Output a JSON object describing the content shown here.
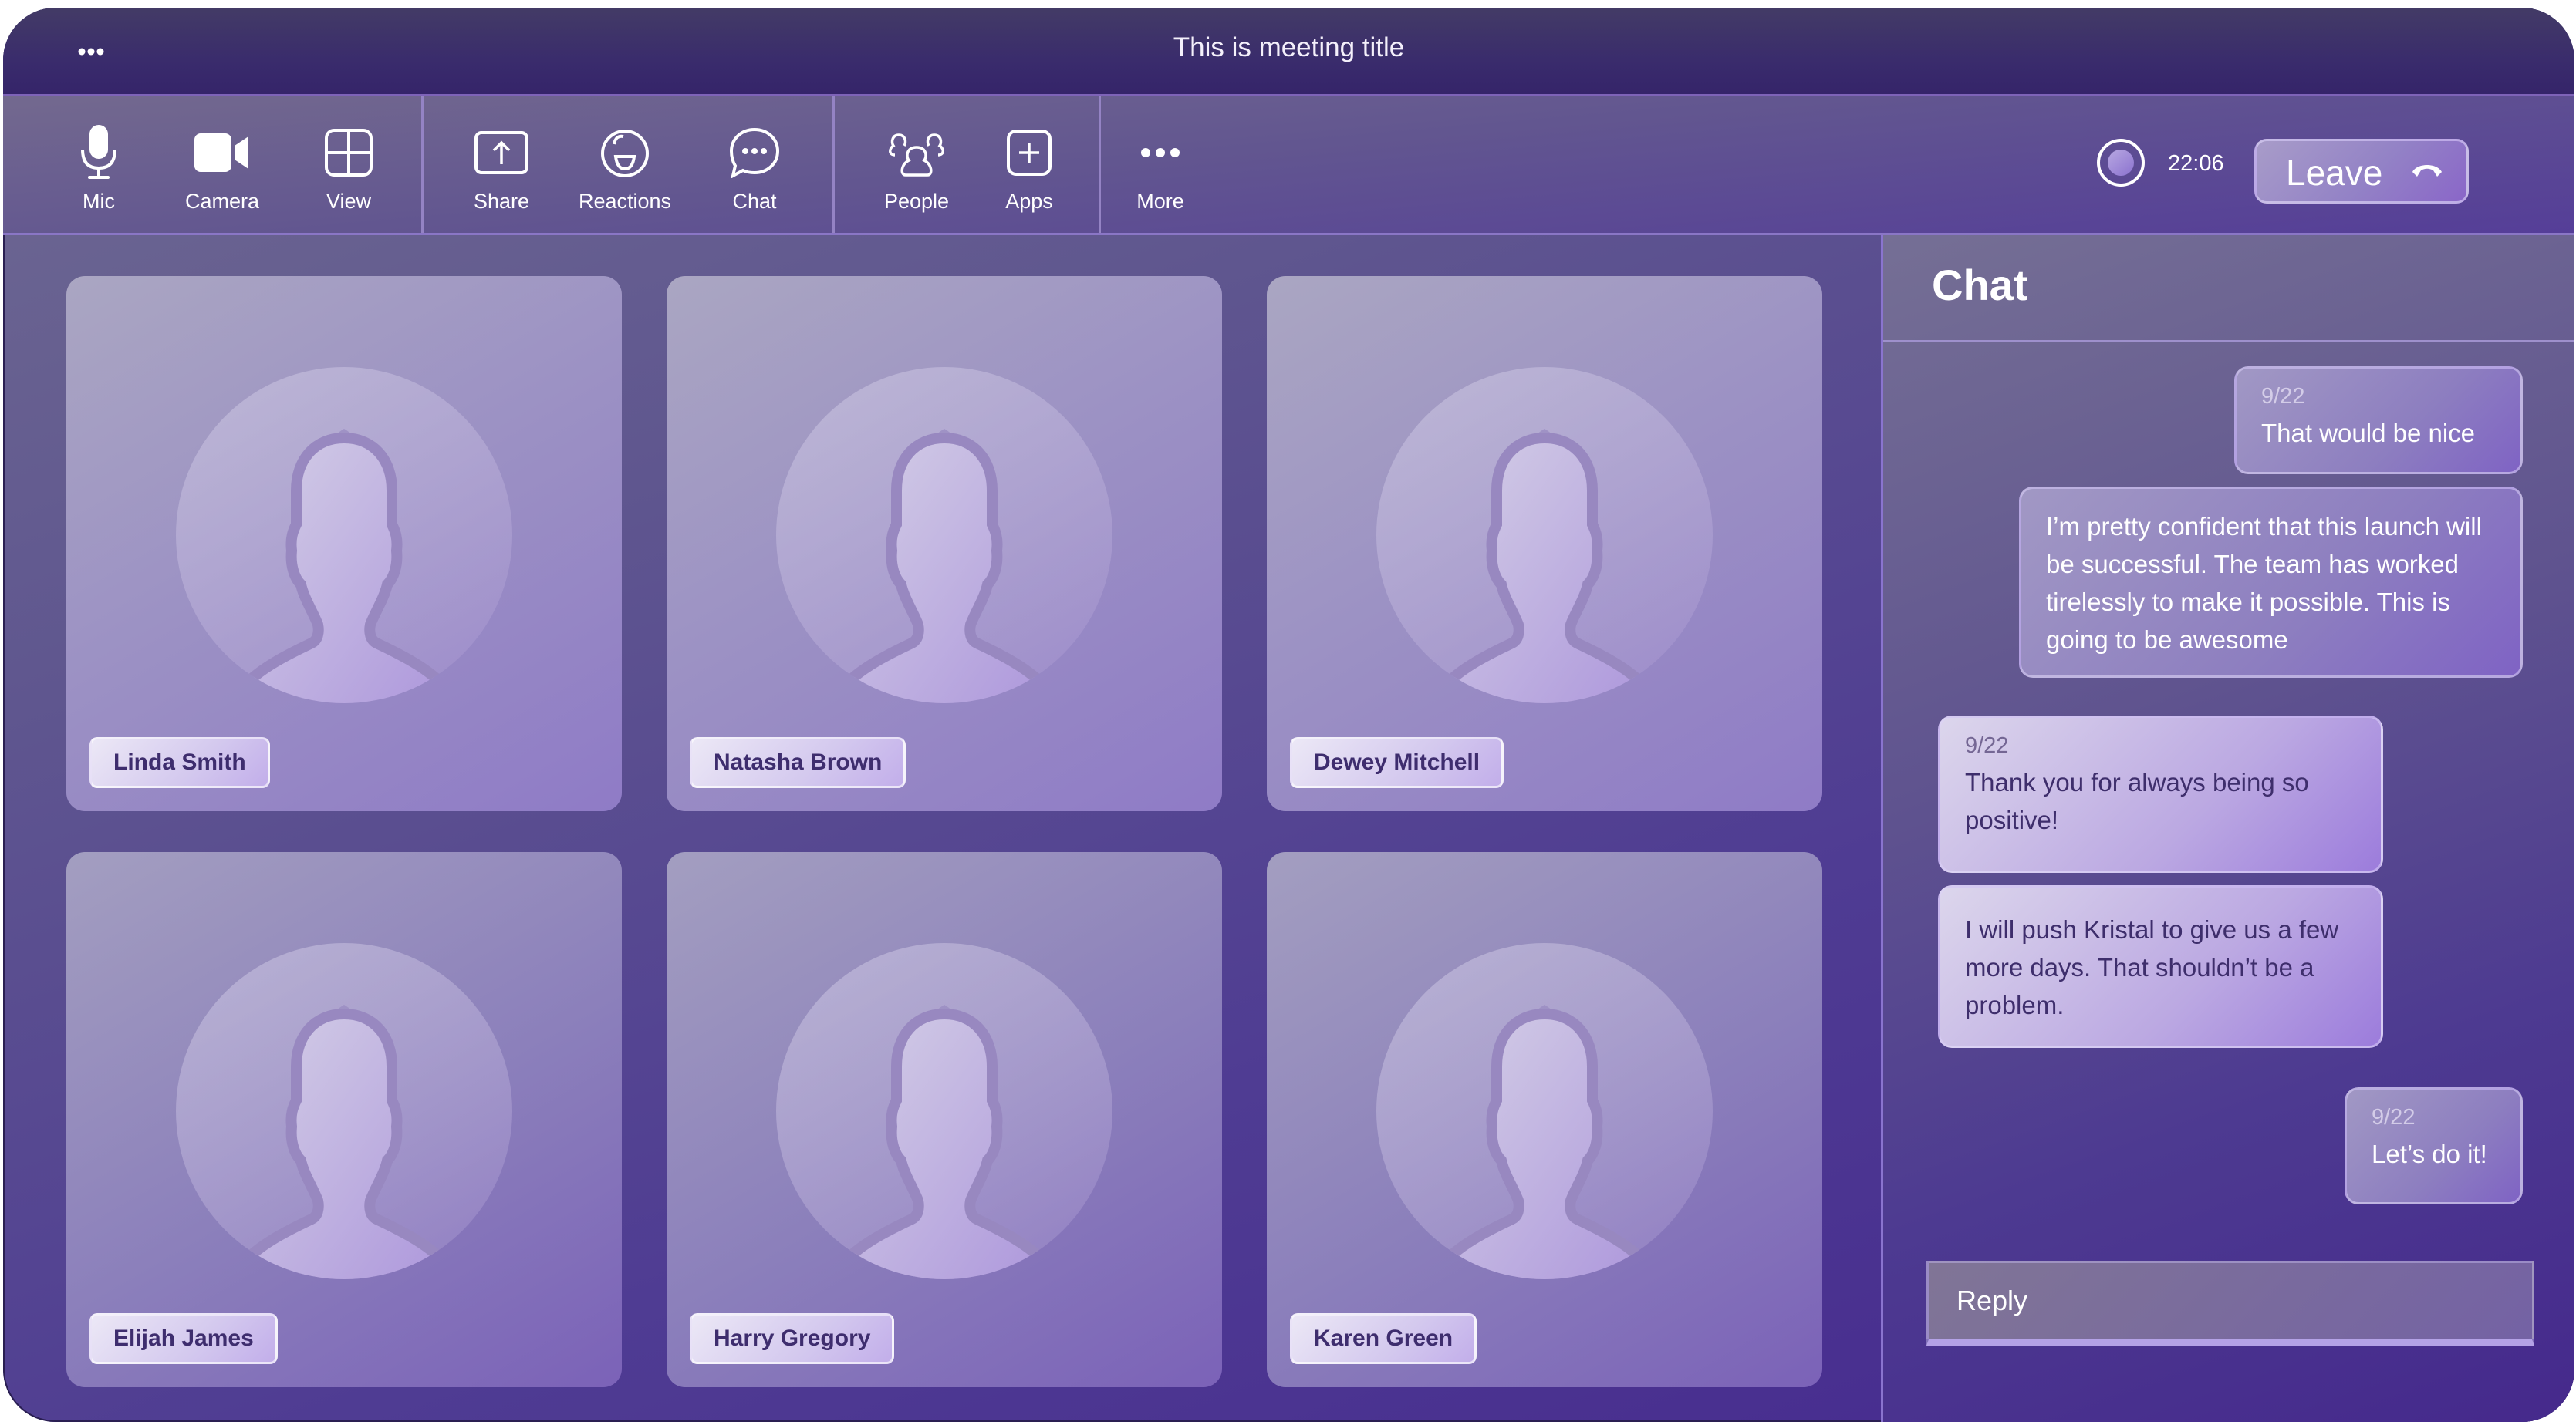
{
  "window": {
    "title": "This is meeting title",
    "menu_icon": "more-horizontal-icon"
  },
  "toolbar": {
    "groups": [
      {
        "buttons": [
          {
            "label": "Mic",
            "icon": "microphone-icon"
          },
          {
            "label": "Camera",
            "icon": "video-camera-icon"
          },
          {
            "label": "View",
            "icon": "grid-view-icon"
          }
        ]
      },
      {
        "buttons": [
          {
            "label": "Share",
            "icon": "share-screen-icon"
          },
          {
            "label": "Reactions",
            "icon": "reactions-icon"
          },
          {
            "label": "Chat",
            "icon": "chat-bubble-icon"
          }
        ]
      },
      {
        "buttons": [
          {
            "label": "People",
            "icon": "people-icon"
          },
          {
            "label": "Apps",
            "icon": "add-app-icon"
          }
        ]
      },
      {
        "buttons": [
          {
            "label": "More",
            "icon": "more-horizontal-icon"
          }
        ]
      }
    ],
    "recording_icon": "record-icon",
    "timer": "22:06",
    "leave_label": "Leave",
    "leave_icon": "hang-up-icon"
  },
  "participants": [
    {
      "name": "Linda Smith"
    },
    {
      "name": "Natasha Brown"
    },
    {
      "name": "Dewey Mitchell"
    },
    {
      "name": "Elijah James"
    },
    {
      "name": "Harry Gregory"
    },
    {
      "name": "Karen Green"
    }
  ],
  "chat": {
    "title": "Chat",
    "messages": [
      {
        "date": "9/22",
        "text": "That would be nice",
        "sender": "me"
      },
      {
        "date": "",
        "text": "I’m pretty confident that this launch will be successful. The team has worked tirelessly to make it possible. This is going to be awesome",
        "sender": "me"
      },
      {
        "date": "9/22",
        "text": "Thank you for always being so positive!",
        "sender": "other"
      },
      {
        "date": "",
        "text": "I will push Kristal to give us a few more days. That shouldn’t be a problem.",
        "sender": "other"
      },
      {
        "date": "9/22",
        "text": "Let’s do it!",
        "sender": "me"
      }
    ],
    "reply_placeholder": "Reply"
  },
  "colors": {
    "accent": "#6a4fc0",
    "title_bar": "#3a2c6c",
    "name_tag_text": "#3e2d6e"
  }
}
